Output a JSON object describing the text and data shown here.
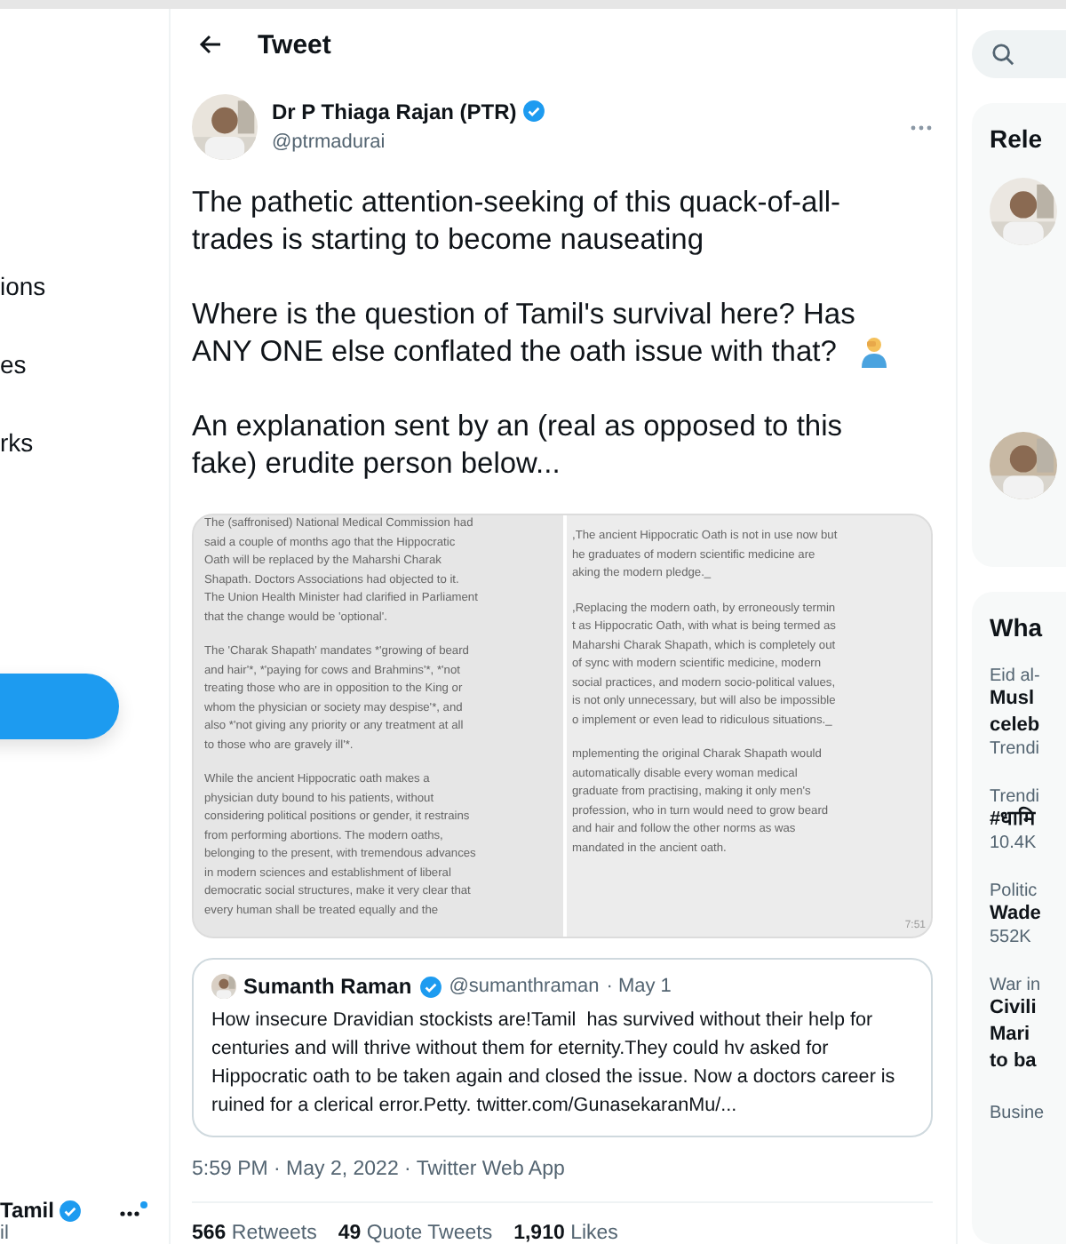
{
  "sidebar": {
    "items": [
      {
        "label": "ions"
      },
      {
        "label": "es"
      },
      {
        "label": "rks"
      }
    ],
    "account": {
      "name": "Tamil",
      "handle": "il",
      "verified": true,
      "unread": true
    }
  },
  "header": {
    "title": "Tweet"
  },
  "tweet": {
    "author": {
      "name": "Dr P Thiaga Rajan (PTR)",
      "handle": "@ptrmadurai",
      "verified": true
    },
    "paragraphs": [
      [
        "The pathetic attention-seeking of this quack-of-all-",
        "trades is starting to become nauseating"
      ],
      [
        "Where is the question of Tamil's survival here? Has",
        "ANY ONE else conflated the oath issue with that?"
      ],
      [
        "An explanation sent by an (real as opposed to this",
        "fake) erudite person below..."
      ]
    ],
    "attachment": {
      "column_1": [
        [
          "The (saffronised) National Medical Commission had",
          "said a couple of months ago that the Hippocratic",
          "Oath will be replaced by the Maharshi Charak",
          "Shapath. Doctors Associations had objected to it.",
          "The Union Health Minister had clarified in Parliament",
          "that the change would be 'optional'."
        ],
        [
          "The 'Charak Shapath' mandates *'growing of beard",
          "and hair'*, *'paying for cows and Brahmins'*, *'not",
          "treating those who are in opposition to the King or",
          "whom the physician or society may despise'*, and",
          "also *'not giving any priority or any treatment at all",
          "to those who are gravely ill'*."
        ],
        [
          "While the ancient Hippocratic oath makes a",
          "physician duty bound to his patients, without",
          "considering political positions or gender, it restrains",
          "from performing abortions. The modern oaths,",
          "belonging to the present, with tremendous advances",
          "in modern sciences and establishment of liberal",
          "democratic social structures, make it very clear that",
          "every human shall be treated equally and the"
        ]
      ],
      "column_2": [
        [
          ",The ancient Hippocratic Oath is not in use now but",
          "he graduates of modern scientific medicine are",
          "aking the modern pledge._"
        ],
        [
          ",Replacing the modern oath, by erroneously termin",
          "t as Hippocratic Oath, with what is being termed as",
          "Maharshi Charak Shapath, which is completely out",
          "of sync with modern scientific medicine, modern",
          "social practices, and modern socio-political values,",
          "is not only unnecessary, but will also be impossible",
          "o implement or even lead to ridiculous situations._"
        ],
        [
          "mplementing the original Charak Shapath would",
          "automatically disable every woman medical",
          "graduate from practising, making it only men's",
          "profession, who in turn would need to grow beard",
          "and hair and follow the other norms as was",
          "mandated in the ancient oath."
        ]
      ],
      "time": "7:51"
    },
    "quote": {
      "name": "Sumanth Raman",
      "verified": true,
      "handle": "@sumanthraman",
      "date": "· May 1",
      "lines": [
        "How insecure Dravidian stockists are!Tamil  has survived without their help for",
        "centuries and will thrive without them for eternity.They could hv asked for",
        "Hippocratic oath to be taken again and closed the issue. Now a doctors career is",
        "ruined for a clerical error.Petty. twitter.com/GunasekaranMu/..."
      ]
    },
    "meta": "5:59 PM · May 2, 2022 · Twitter Web App",
    "stats": [
      {
        "count": "566",
        "label": "Retweets"
      },
      {
        "count": "49",
        "label": "Quote Tweets"
      },
      {
        "count": "1,910",
        "label": "Likes"
      }
    ]
  },
  "right": {
    "relevant_heading": "Rele",
    "whats_heading": "Wha",
    "trends": [
      {
        "context": "Eid al-",
        "lines": [
          "Musl",
          "celeb"
        ],
        "footer": "Trendi"
      },
      {
        "context": "Trendi",
        "lines": [
          "#धामि"
        ],
        "footer": "10.4K"
      },
      {
        "context": "Politic",
        "lines": [
          "Wade"
        ],
        "footer": "552K"
      },
      {
        "context": "War in",
        "lines": [
          "Civili",
          "Mari",
          "to ba"
        ]
      },
      {
        "context": "Busine"
      }
    ]
  }
}
